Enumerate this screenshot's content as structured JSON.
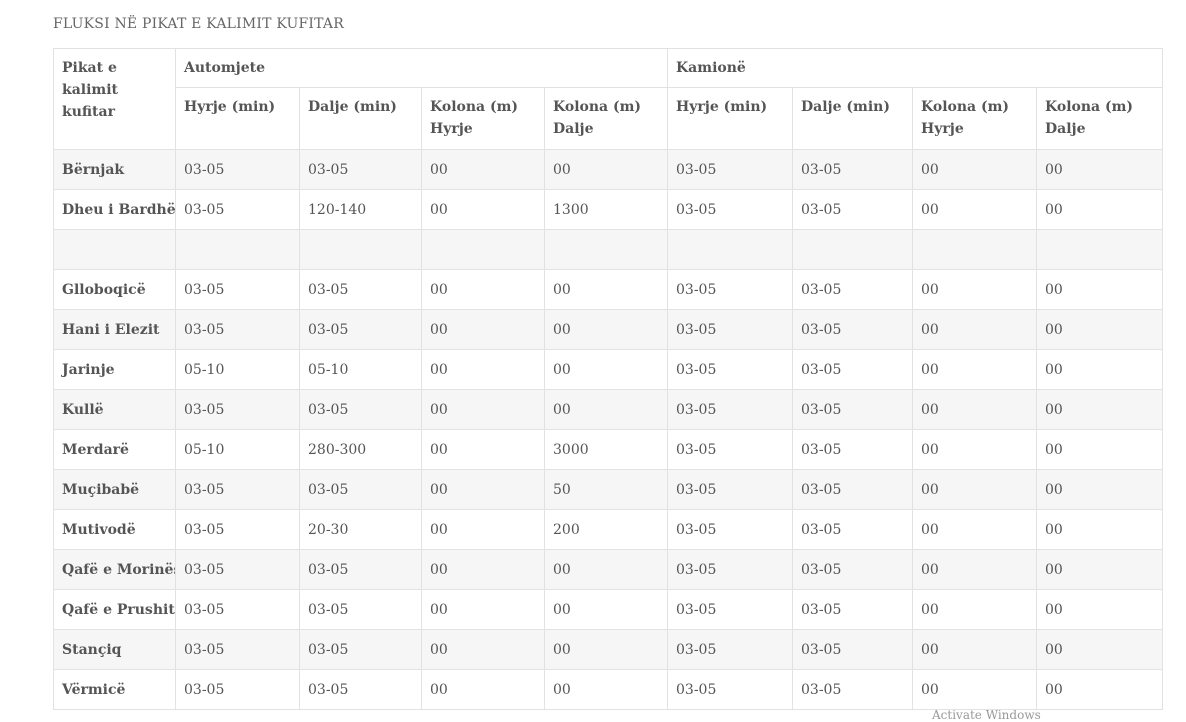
{
  "title": "FLUKSI NË PIKAT E KALIMIT KUFITAR",
  "header": {
    "corner": "Pikat e kalimit kufitar",
    "group_a": "Automjete",
    "group_b": "Kamionë",
    "cols": [
      "Hyrje (min)",
      "Dalje (min)",
      "Kolona (m) Hyrje",
      "Kolona (m) Dalje",
      "Hyrje (min)",
      "Dalje (min)",
      "Kolona (m) Hyrje",
      "Kolona (m) Dalje"
    ]
  },
  "rows": [
    {
      "name": "Bërnjak",
      "v": [
        "03-05",
        "03-05",
        "00",
        "00",
        "03-05",
        "03-05",
        "00",
        "00"
      ]
    },
    {
      "name": "Dheu i Bardhë",
      "v": [
        "03-05",
        "120-140",
        "00",
        "1300",
        "03-05",
        "03-05",
        "00",
        "00"
      ]
    },
    {
      "name": "",
      "v": [
        "",
        "",
        "",
        "",
        "",
        "",
        "",
        ""
      ]
    },
    {
      "name": "Glloboqicë",
      "v": [
        "03-05",
        "03-05",
        "00",
        "00",
        "03-05",
        "03-05",
        "00",
        "00"
      ]
    },
    {
      "name": "Hani i Elezit",
      "v": [
        "03-05",
        "03-05",
        "00",
        "00",
        "03-05",
        "03-05",
        "00",
        "00"
      ]
    },
    {
      "name": "Jarinje",
      "v": [
        "05-10",
        "05-10",
        "00",
        "00",
        "03-05",
        "03-05",
        "00",
        "00"
      ]
    },
    {
      "name": "Kullë",
      "v": [
        "03-05",
        "03-05",
        "00",
        "00",
        "03-05",
        "03-05",
        "00",
        "00"
      ]
    },
    {
      "name": "Merdarë",
      "v": [
        "05-10",
        "280-300",
        "00",
        "3000",
        "03-05",
        "03-05",
        "00",
        "00"
      ]
    },
    {
      "name": "Muçibabë",
      "v": [
        "03-05",
        "03-05",
        "00",
        "50",
        "03-05",
        "03-05",
        "00",
        "00"
      ]
    },
    {
      "name": "Mutivodë",
      "v": [
        "03-05",
        "20-30",
        "00",
        "200",
        "03-05",
        "03-05",
        "00",
        "00"
      ]
    },
    {
      "name": "Qafë e Morinës",
      "v": [
        "03-05",
        "03-05",
        "00",
        "00",
        "03-05",
        "03-05",
        "00",
        "00"
      ]
    },
    {
      "name": "Qafë e Prushit",
      "v": [
        "03-05",
        "03-05",
        "00",
        "00",
        "03-05",
        "03-05",
        "00",
        "00"
      ]
    },
    {
      "name": "Stançiq",
      "v": [
        "03-05",
        "03-05",
        "00",
        "00",
        "03-05",
        "03-05",
        "00",
        "00"
      ]
    },
    {
      "name": "Vërmicë",
      "v": [
        "03-05",
        "03-05",
        "00",
        "00",
        "03-05",
        "03-05",
        "00",
        "00"
      ]
    }
  ],
  "watermark": "Activate Windows"
}
